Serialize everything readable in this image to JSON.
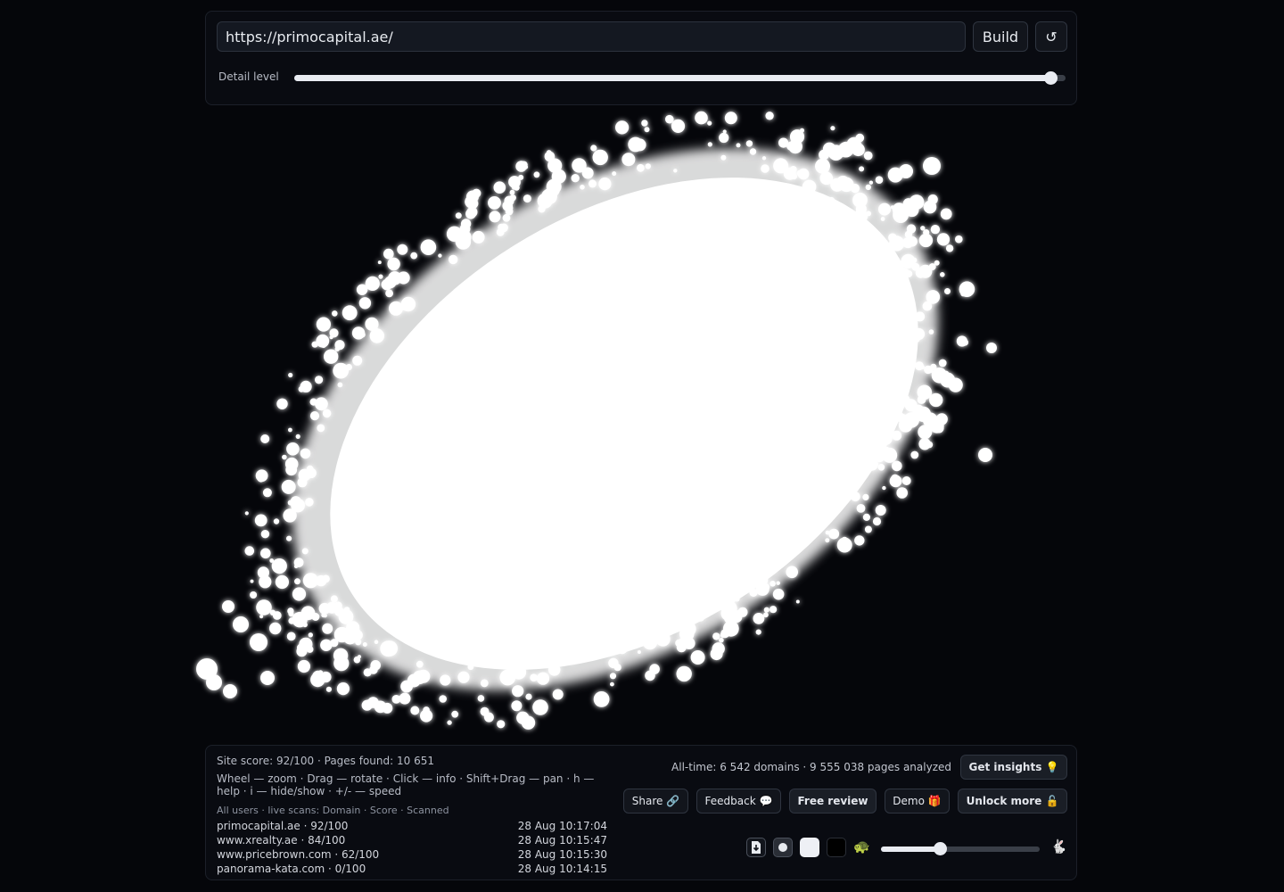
{
  "top": {
    "url_value": "https://primocapital.ae/",
    "build_label": "Build",
    "reload_icon": "↺",
    "detail_label": "Detail level",
    "detail_level": 0.98
  },
  "visualization": {
    "icon": "point-cloud",
    "color": "#ffffff",
    "background": "#05060a"
  },
  "stats": {
    "site_line": "Site score: 92/100 · Pages found: 10 651",
    "help_text": "Wheel — zoom · Drag — rotate · Click — info · Shift+Drag — pan · h — help · i — hide/show · +/- — speed",
    "scans_header": "All users · live scans: Domain · Score · Scanned",
    "all_time": "All-time: 6 542 domains · 9 555 038 pages analyzed"
  },
  "scans": [
    {
      "domain": "primocapital.ae · 92/100",
      "time": "28 Aug 10:17:04"
    },
    {
      "domain": "www.xrealty.ae · 84/100",
      "time": "28 Aug 10:15:47"
    },
    {
      "domain": "www.pricebrown.com · 62/100",
      "time": "28 Aug 10:15:30"
    },
    {
      "domain": "panorama-kata.com · 0/100",
      "time": "28 Aug 10:14:15"
    }
  ],
  "actions": {
    "get_insights": "Get insights 💡",
    "share": "Share 🔗",
    "feedback": "Feedback 💬",
    "free_review": "Free review",
    "demo": "Demo 🎁",
    "unlock": "Unlock more 🔓"
  },
  "controls": {
    "download_icon": "download-icon",
    "slow_emoji": "🐢",
    "fast_emoji": "🐇",
    "speed": 0.37
  }
}
